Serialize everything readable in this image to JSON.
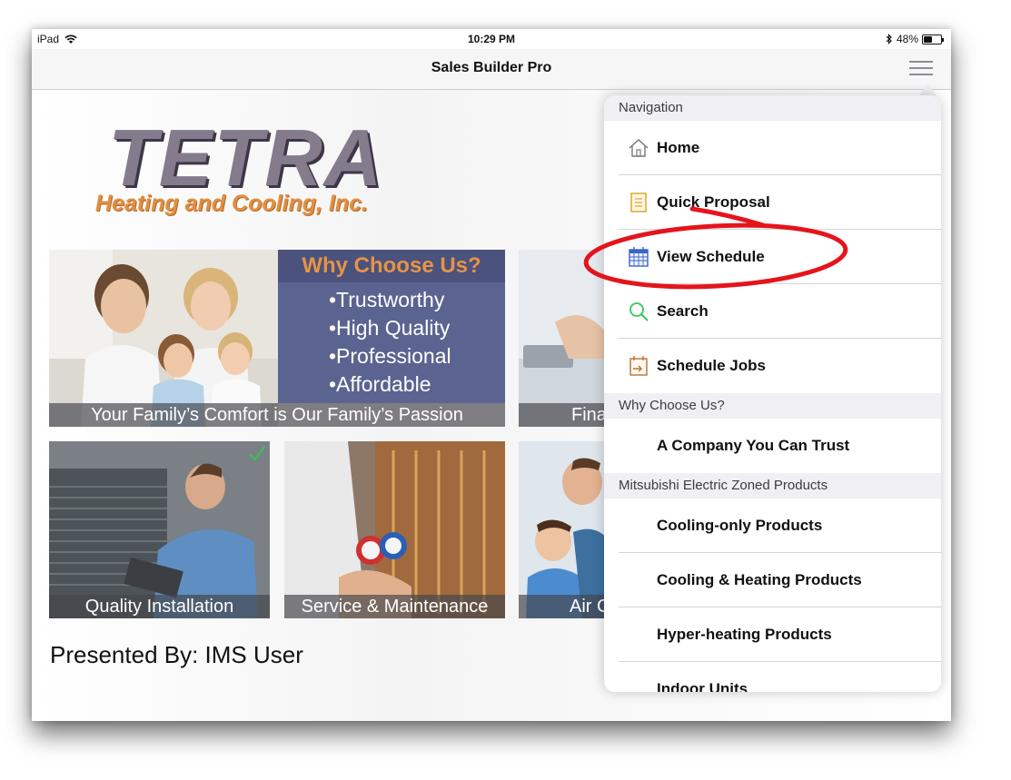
{
  "status": {
    "device": "iPad",
    "time": "10:29 PM",
    "battery": "48%",
    "battery_level": 0.48
  },
  "navbar": {
    "title": "Sales Builder Pro"
  },
  "logo": {
    "main": "TETRA",
    "sub": "Heating and Cooling, Inc."
  },
  "hero": {
    "caption": "Your Family’s Comfort is Our Family’s Passion",
    "why_title": "Why Choose Us?",
    "why_items": [
      "•Trustworthy",
      "•High Quality",
      "•Professional",
      "•Affordable"
    ],
    "partial_caption": "Fina"
  },
  "tiles": [
    {
      "caption": "Quality Installation"
    },
    {
      "caption": "Service & Maintenance"
    },
    {
      "caption": "Air C"
    }
  ],
  "presented": {
    "label": "Presented By:",
    "user": "IMS User"
  },
  "menu": {
    "sections": [
      {
        "title": "Navigation",
        "items": [
          {
            "label": "Home",
            "icon": "house-icon"
          },
          {
            "label": "Quick Proposal",
            "icon": "document-icon"
          },
          {
            "label": "View Schedule",
            "icon": "calendar-icon"
          },
          {
            "label": "Search",
            "icon": "magnifier-icon"
          },
          {
            "label": "Schedule Jobs",
            "icon": "schedule-jobs-icon"
          }
        ]
      },
      {
        "title": "Why Choose Us?",
        "items": [
          {
            "label": "A Company You Can Trust"
          }
        ]
      },
      {
        "title": "Mitsubishi Electric Zoned Products",
        "items": [
          {
            "label": "Cooling-only Products"
          },
          {
            "label": "Cooling & Heating Products"
          },
          {
            "label": "Hyper-heating Products"
          },
          {
            "label": "Indoor Units"
          }
        ]
      }
    ]
  },
  "colors": {
    "annotation": "#e5141c",
    "accent_orange": "#e08f42",
    "panel_blue": "#5b6490",
    "menu_icon": "#3a63c9"
  }
}
